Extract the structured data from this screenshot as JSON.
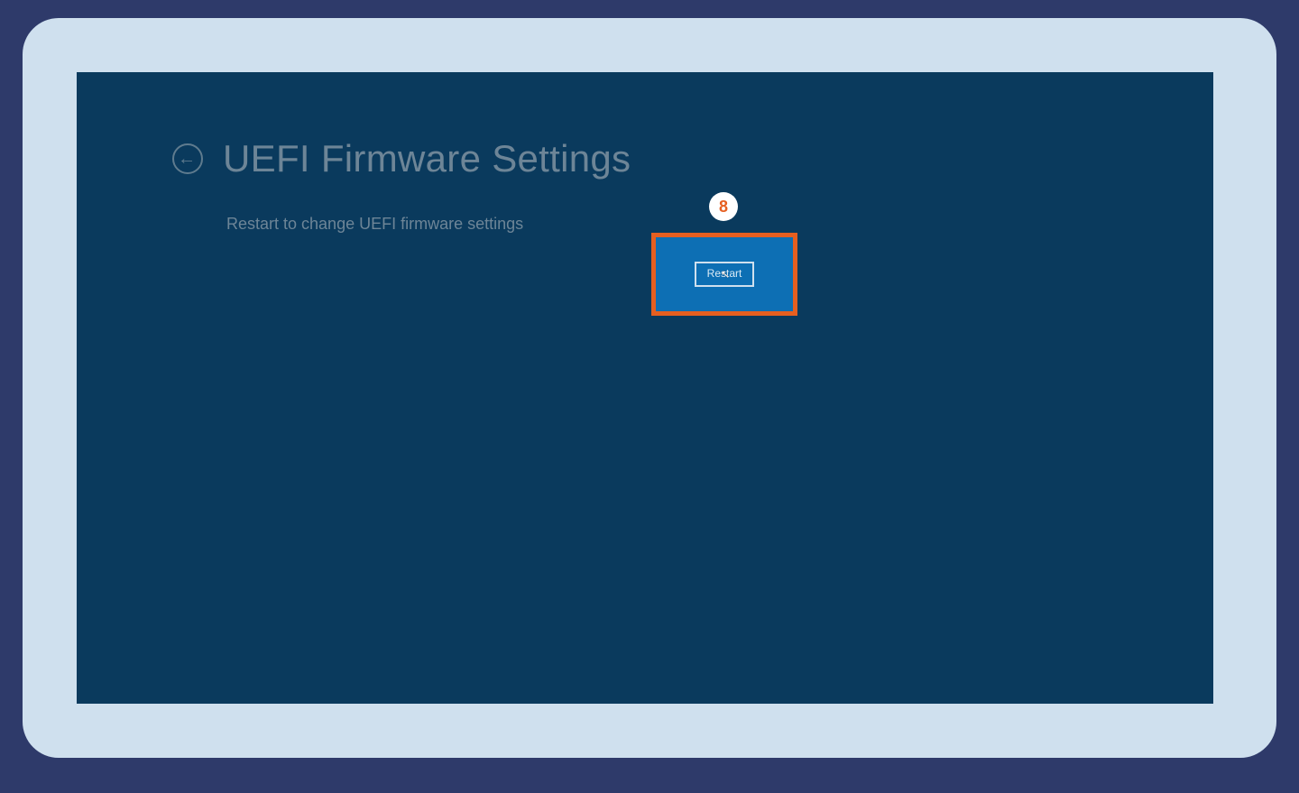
{
  "header": {
    "title": "UEFI Firmware Settings",
    "subtitle": "Restart to change UEFI firmware settings"
  },
  "annotation": {
    "step_number": "8"
  },
  "actions": {
    "restart_label": "Restart"
  },
  "colors": {
    "page_bg": "#2e3a6a",
    "frame_bg": "#cfe0ee",
    "screen_bg": "#0a3a5d",
    "accent_orange": "#e65f20",
    "button_bg": "#0d6fb4",
    "text_muted": "#6d8597"
  }
}
